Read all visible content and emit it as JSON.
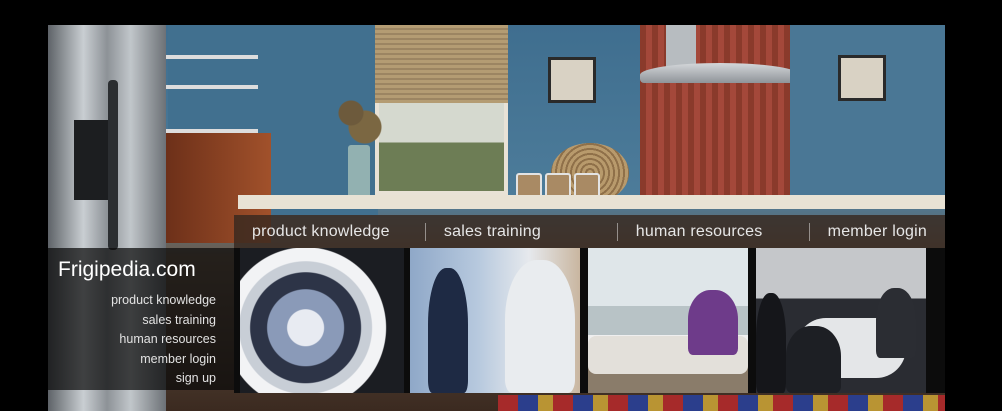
{
  "top_nav": {
    "items": [
      "product knowledge",
      "sales training",
      "human resources",
      "member login"
    ]
  },
  "brand": {
    "logo": "Frigipedia.com"
  },
  "side_nav": {
    "items": [
      "product knowledge",
      "sales training",
      "human resources",
      "member login",
      "sign up"
    ]
  },
  "tiles": [
    {
      "icon": "front-load-washer-photo"
    },
    {
      "icon": "sales-meeting-photo"
    },
    {
      "icon": "woman-on-sofa-photo"
    },
    {
      "icon": "business-conference-photo"
    }
  ]
}
